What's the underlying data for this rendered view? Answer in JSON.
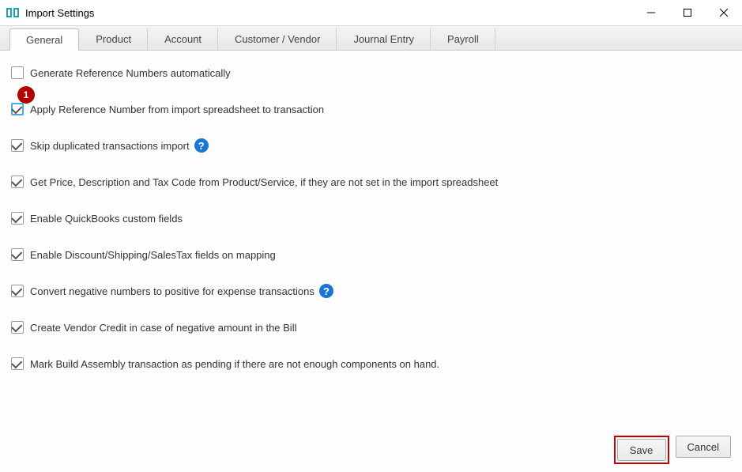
{
  "window": {
    "title": "Import Settings"
  },
  "tabs": [
    {
      "label": "General",
      "active": true
    },
    {
      "label": "Product",
      "active": false
    },
    {
      "label": "Account",
      "active": false
    },
    {
      "label": "Customer / Vendor",
      "active": false
    },
    {
      "label": "Journal Entry",
      "active": false
    },
    {
      "label": "Payroll",
      "active": false
    }
  ],
  "badge": "1",
  "options": [
    {
      "label": "Generate Reference Numbers automatically",
      "checked": false,
      "highlighted": false,
      "help": false
    },
    {
      "label": "Apply Reference Number from import spreadsheet to transaction",
      "checked": true,
      "highlighted": true,
      "help": false
    },
    {
      "label": "Skip duplicated transactions import",
      "checked": true,
      "highlighted": false,
      "help": true
    },
    {
      "label": "Get Price, Description and Tax Code from Product/Service, if they are not set in the import spreadsheet",
      "checked": true,
      "highlighted": false,
      "help": false
    },
    {
      "label": "Enable QuickBooks custom fields",
      "checked": true,
      "highlighted": false,
      "help": false
    },
    {
      "label": "Enable Discount/Shipping/SalesTax fields on mapping",
      "checked": true,
      "highlighted": false,
      "help": false
    },
    {
      "label": "Convert negative numbers to positive for expense transactions",
      "checked": true,
      "highlighted": false,
      "help": true
    },
    {
      "label": "Create Vendor Credit in case of negative amount in the Bill",
      "checked": true,
      "highlighted": false,
      "help": false
    },
    {
      "label": "Mark Build Assembly transaction as pending if there are not enough components on hand.",
      "checked": true,
      "highlighted": false,
      "help": false
    }
  ],
  "buttons": {
    "save": "Save",
    "cancel": "Cancel"
  },
  "help_glyph": "?"
}
